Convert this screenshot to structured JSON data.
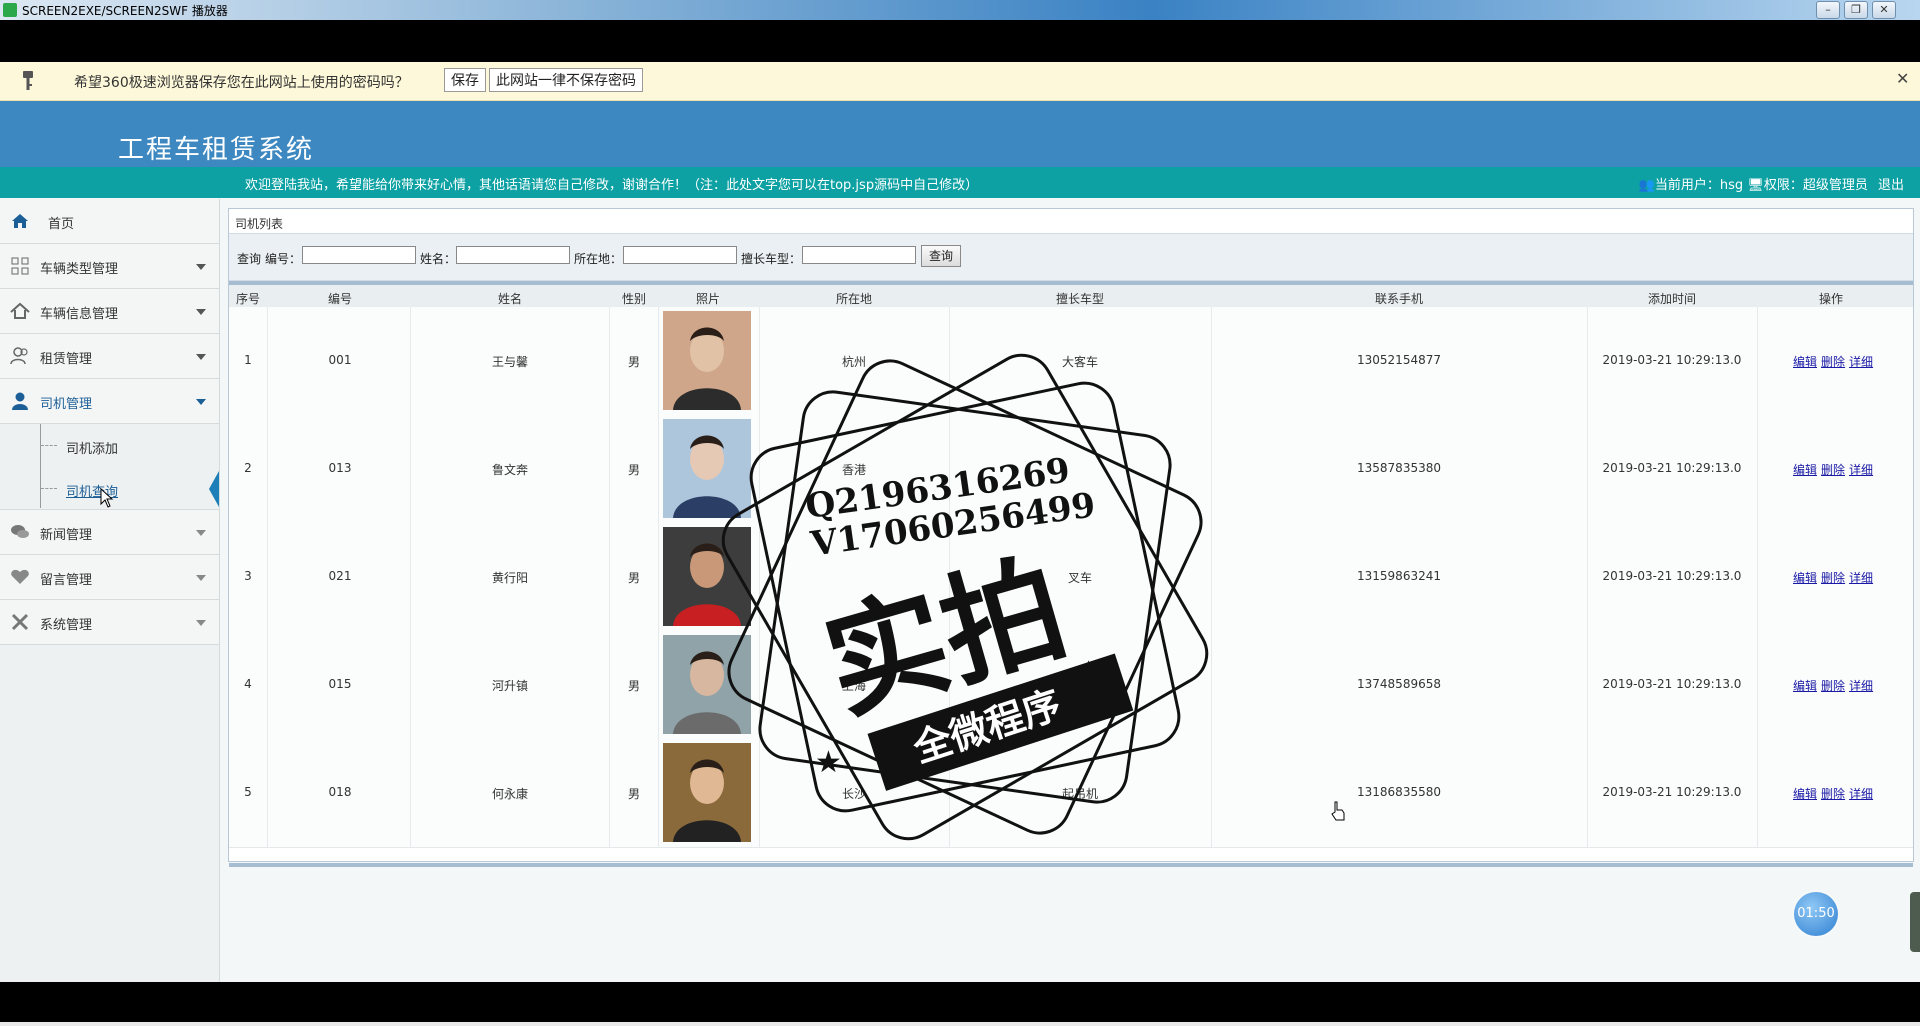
{
  "window": {
    "title": "SCREEN2EXE/SCREEN2SWF 播放器",
    "buttons": [
      "minimize-icon",
      "restore-icon",
      "close-icon"
    ]
  },
  "password_bar": {
    "message": "希望360极速浏览器保存您在此网站上使用的密码吗？",
    "save_label": "保存",
    "never_label": "此网站一律不保存密码",
    "close_glyph": "✕"
  },
  "header": {
    "system_title": "工程车租赁系统",
    "welcome_text": "欢迎登陆我站，希望能给你带来好心情，其他话语请您自己修改，谢谢合作！（注：此处文字您可以在top.jsp源码中自己修改）",
    "current_user": "当前用户：hsg",
    "permission": "权限：超级管理员",
    "logout": "退出"
  },
  "sidebar": {
    "items": [
      {
        "label": "首页",
        "icon": "home-icon",
        "expandable": false
      },
      {
        "label": "车辆类型管理",
        "icon": "grid-icon",
        "expandable": true
      },
      {
        "label": "车辆信息管理",
        "icon": "house-icon",
        "expandable": true
      },
      {
        "label": "租赁管理",
        "icon": "users-icon",
        "expandable": true
      },
      {
        "label": "司机管理",
        "icon": "user-icon",
        "expandable": true,
        "active": true
      },
      {
        "label": "新闻管理",
        "icon": "chat-icon",
        "expandable": true
      },
      {
        "label": "留言管理",
        "icon": "heart-icon",
        "expandable": true
      },
      {
        "label": "系统管理",
        "icon": "tools-icon",
        "expandable": true
      }
    ],
    "sub_items": [
      {
        "label": "司机添加"
      },
      {
        "label": "司机查询",
        "selected": true
      }
    ]
  },
  "panel": {
    "title": "司机列表",
    "search": {
      "query_label": "查询",
      "code_label": "编号：",
      "name_label": "姓名：",
      "location_label": "所在地：",
      "vehicle_label": "擅长车型：",
      "code_value": "",
      "name_value": "",
      "location_value": "",
      "vehicle_value": "",
      "button_label": "查询"
    },
    "columns": [
      "序号",
      "编号",
      "姓名",
      "性别",
      "照片",
      "所在地",
      "擅长车型",
      "联系手机",
      "添加时间",
      "操作"
    ],
    "rows": [
      {
        "index": "1",
        "code": "001",
        "name": "王与馨",
        "gender": "男",
        "location": "杭州",
        "vehicle": "大客车",
        "phone": "13052154877",
        "added": "2019-03-21 10:29:13.0"
      },
      {
        "index": "2",
        "code": "013",
        "name": "鲁文奔",
        "gender": "男",
        "location": "香港",
        "vehicle": "",
        "phone": "13587835380",
        "added": "2019-03-21 10:29:13.0"
      },
      {
        "index": "3",
        "code": "021",
        "name": "黄行阳",
        "gender": "男",
        "location": "",
        "vehicle": "叉车",
        "phone": "13159863241",
        "added": "2019-03-21 10:29:13.0"
      },
      {
        "index": "4",
        "code": "015",
        "name": "河升镇",
        "gender": "男",
        "location": "上海",
        "vehicle": "挖土机",
        "phone": "13748589658",
        "added": "2019-03-21 10:29:13.0"
      },
      {
        "index": "5",
        "code": "018",
        "name": "何永康",
        "gender": "男",
        "location": "长沙",
        "vehicle": "起吊机",
        "phone": "13186835580",
        "added": "2019-03-21 10:29:13.0"
      }
    ],
    "ops": {
      "edit": "编辑",
      "delete": "删除",
      "detail": "详细"
    }
  },
  "watermark": {
    "line1": "Q2196316269",
    "line2": "V17060256499",
    "big": "实拍",
    "banner": "全微程序"
  },
  "timer": "01:50",
  "colors": {
    "header_blue": "#3d88c0",
    "welcome_teal": "#0ea1a3",
    "link_blue": "#1a1aa6",
    "active_nav": "#1c5e96"
  }
}
